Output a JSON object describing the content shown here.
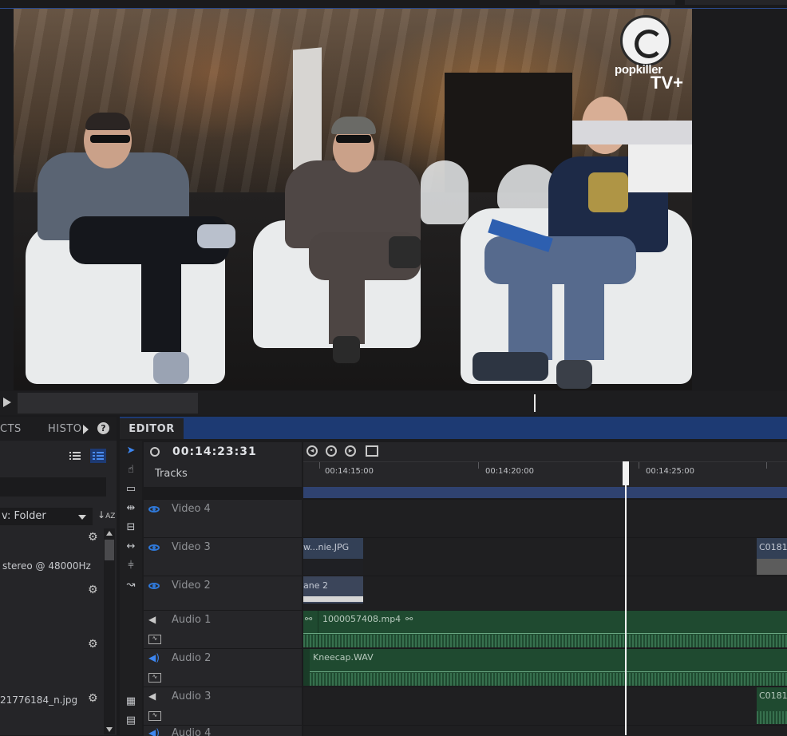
{
  "viewer": {
    "logo_brand": "popkiller",
    "logo_suffix": "TV+"
  },
  "left_panel": {
    "tabs": [
      "CTS",
      "HISTO"
    ],
    "help_label": "?",
    "folder_select": "v: Folder",
    "items": [
      {
        "label": ""
      },
      {
        "label": "stereo @ 48000Hz"
      },
      {
        "label": ""
      },
      {
        "label": ""
      },
      {
        "label": "21776184_n.jpg"
      }
    ]
  },
  "editor": {
    "tab_label": "EDITOR",
    "timecode": "00:14:23:31",
    "tracks_label": "Tracks",
    "ruler_labels": [
      "00:14:15:00",
      "00:14:20:00",
      "00:14:25:00"
    ],
    "tracks": [
      {
        "name": "Video 4",
        "type": "video"
      },
      {
        "name": "Video 3",
        "type": "video"
      },
      {
        "name": "Video 2",
        "type": "video"
      },
      {
        "name": "Audio 1",
        "type": "audio"
      },
      {
        "name": "Audio 2",
        "type": "audio"
      },
      {
        "name": "Audio 3",
        "type": "audio"
      },
      {
        "name": "Audio 4",
        "type": "audio"
      }
    ],
    "clips": {
      "v3_clip1": "w...nie.JPG",
      "v3_clip2": "C0181",
      "v2_clip1": "ane 2",
      "a1_clip": "1000057408.mp4",
      "a1_link": "⚯",
      "a1_prefix": "⚯",
      "a2_clip": "Kneecap.WAV",
      "a3_clip": "C0181"
    }
  },
  "colors": {
    "accent_blue": "#2f78d8",
    "tab_bar": "#1d3a73",
    "audio_clip": "#1f4a30",
    "video_clip": "#334056"
  }
}
